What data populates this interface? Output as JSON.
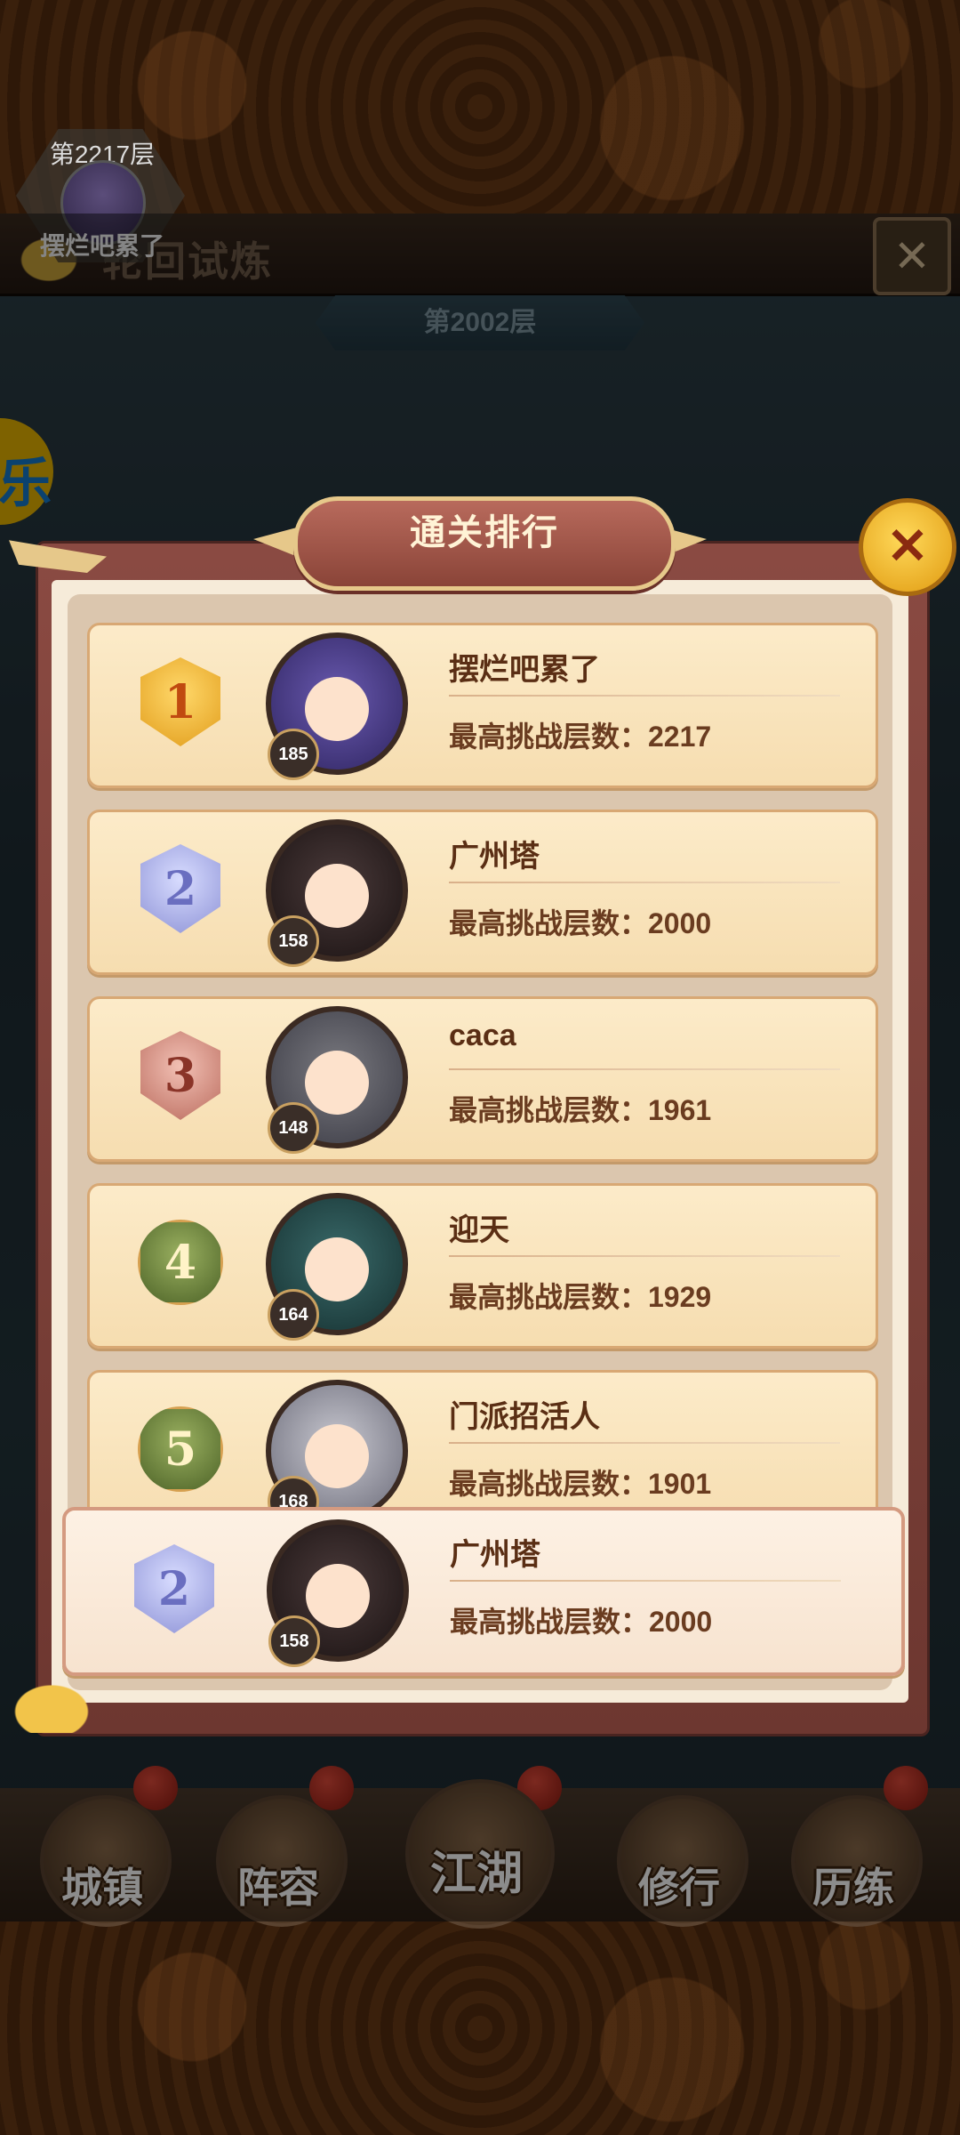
{
  "scene": {
    "title": "轮回试炼",
    "floor_banner": "第2002层",
    "player_badge": {
      "floor": "第2217层",
      "name": "摆烂吧累了"
    },
    "side_icon_glyph": "乐"
  },
  "modal": {
    "title": "通关排行",
    "close_icon": "close-sword-icon"
  },
  "rankings": [
    {
      "rank": "1",
      "level": "185",
      "name": "摆烂吧累了",
      "score": "最高挑战层数：2217"
    },
    {
      "rank": "2",
      "level": "158",
      "name": "广州塔",
      "score": "最高挑战层数：2000"
    },
    {
      "rank": "3",
      "level": "148",
      "name": "caca",
      "score": "最高挑战层数：1961"
    },
    {
      "rank": "4",
      "level": "164",
      "name": "迎天",
      "score": "最高挑战层数：1929"
    },
    {
      "rank": "5",
      "level": "168",
      "name": "门派招活人",
      "score": "最高挑战层数：1901"
    }
  ],
  "my_rank": {
    "rank": "2",
    "level": "158",
    "name": "广州塔",
    "score": "最高挑战层数：2000"
  },
  "bottom_nav": [
    {
      "label": "城镇"
    },
    {
      "label": "阵容"
    },
    {
      "label": "江湖"
    },
    {
      "label": "修行"
    },
    {
      "label": "历练"
    }
  ],
  "colors": {
    "medal_gold": "#f2b630",
    "medal_silver": "#9aa0e0",
    "medal_bronze": "#c97a6c",
    "medal_green": "#6f8a44",
    "name_text": "#5a2e14"
  }
}
